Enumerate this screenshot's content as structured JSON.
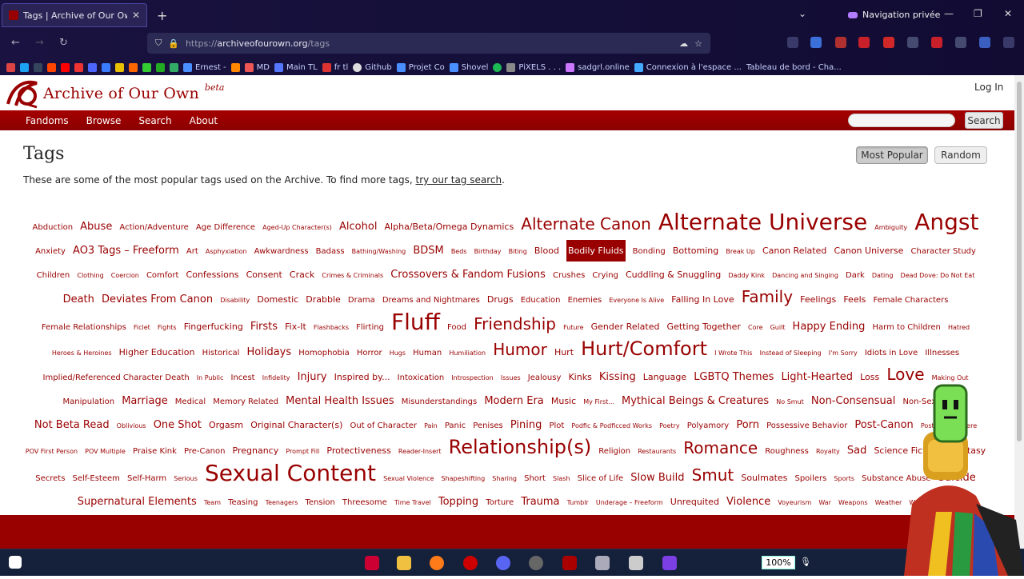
{
  "browser": {
    "tab_title": "Tags | Archive of Our Own",
    "tab_close": "✕",
    "new_tab": "+",
    "private_label": "Navigation privée",
    "url_prefix": "https://",
    "url_host": "archiveofourown.org",
    "url_path": "/tags",
    "bookmarks": [
      "Ernest -",
      "MD",
      "Main TL",
      "fr tl",
      "Github",
      "Projet Co",
      "Shovel",
      "PiXELS . . .",
      "sadgrl.online",
      "Connexion à l'espace ...",
      "Tableau de bord - Cha..."
    ]
  },
  "site": {
    "name": "Archive of Our Own",
    "beta": "beta",
    "login": "Log In",
    "nav": [
      "Fandoms",
      "Browse",
      "Search",
      "About"
    ],
    "search_button": "Search"
  },
  "main": {
    "heading": "Tags",
    "sort_options": [
      "Most Popular",
      "Random"
    ],
    "active_sort": "Most Popular",
    "intro_text": "These are some of the most popular tags used on the Archive. To find more tags, ",
    "intro_link": "try our tag search",
    "intro_end": ".",
    "tags": [
      [
        "Abduction",
        1
      ],
      [
        "Abuse",
        3
      ],
      [
        "Action/Adventure",
        1
      ],
      [
        "Age Difference",
        1
      ],
      [
        "Aged-Up Character(s)",
        0
      ],
      [
        "Alcohol",
        3
      ],
      [
        "Alpha/Beta/Omega Dynamics",
        2
      ],
      [
        "Alternate Canon",
        5
      ],
      [
        "Alternate Universe",
        7
      ],
      [
        "Ambiguity",
        0
      ],
      [
        "Angst",
        7
      ],
      [
        "Anxiety",
        1
      ],
      [
        "AO3 Tags – Freeform",
        3
      ],
      [
        "Art",
        1
      ],
      [
        "Asphyxiation",
        0
      ],
      [
        "Awkwardness",
        1
      ],
      [
        "Badass",
        1
      ],
      [
        "Bathing/Washing",
        0
      ],
      [
        "BDSM",
        3
      ],
      [
        "Beds",
        0
      ],
      [
        "Birthday",
        0
      ],
      [
        "Biting",
        0
      ],
      [
        "Blood",
        2
      ],
      [
        "Bodily Fluids",
        2,
        "hl"
      ],
      [
        "Bonding",
        1
      ],
      [
        "Bottoming",
        2
      ],
      [
        "Break Up",
        0
      ],
      [
        "Canon Related",
        2
      ],
      [
        "Canon Universe",
        2
      ],
      [
        "Character Study",
        1
      ],
      [
        "Children",
        1
      ],
      [
        "Clothing",
        0
      ],
      [
        "Coercion",
        0
      ],
      [
        "Comfort",
        1
      ],
      [
        "Confessions",
        2
      ],
      [
        "Consent",
        2
      ],
      [
        "Crack",
        2
      ],
      [
        "Crimes & Criminals",
        0
      ],
      [
        "Crossovers & Fandom Fusions",
        3
      ],
      [
        "Crushes",
        1
      ],
      [
        "Crying",
        1
      ],
      [
        "Cuddling & Snuggling",
        2
      ],
      [
        "Daddy Kink",
        0
      ],
      [
        "Dancing and Singing",
        0
      ],
      [
        "Dark",
        1
      ],
      [
        "Dating",
        0
      ],
      [
        "Dead Dove: Do Not Eat",
        0
      ],
      [
        "Death",
        3
      ],
      [
        "Deviates From Canon",
        3
      ],
      [
        "Disability",
        0
      ],
      [
        "Domestic",
        2
      ],
      [
        "Drabble",
        2
      ],
      [
        "Drama",
        1
      ],
      [
        "Dreams and Nightmares",
        1
      ],
      [
        "Drugs",
        2
      ],
      [
        "Education",
        1
      ],
      [
        "Enemies",
        1
      ],
      [
        "Everyone Is Alive",
        0
      ],
      [
        "Falling In Love",
        2
      ],
      [
        "Family",
        5
      ],
      [
        "Feelings",
        2
      ],
      [
        "Feels",
        2
      ],
      [
        "Female Characters",
        1
      ],
      [
        "Female Relationships",
        1
      ],
      [
        "Ficlet",
        0
      ],
      [
        "Fights",
        0
      ],
      [
        "Fingerfucking",
        2
      ],
      [
        "Firsts",
        3
      ],
      [
        "Fix-It",
        2
      ],
      [
        "Flashbacks",
        0
      ],
      [
        "Flirting",
        1
      ],
      [
        "Fluff",
        7
      ],
      [
        "Food",
        1
      ],
      [
        "Friendship",
        5
      ],
      [
        "Future",
        0
      ],
      [
        "Gender Related",
        2
      ],
      [
        "Getting Together",
        2
      ],
      [
        "Core",
        0
      ],
      [
        "Guilt",
        0
      ],
      [
        "Happy Ending",
        3
      ],
      [
        "Harm to Children",
        1
      ],
      [
        "Hatred",
        0
      ],
      [
        "Heroes & Heroines",
        0
      ],
      [
        "Higher Education",
        2
      ],
      [
        "Historical",
        1
      ],
      [
        "Holidays",
        3
      ],
      [
        "Homophobia",
        1
      ],
      [
        "Horror",
        1
      ],
      [
        "Hugs",
        0
      ],
      [
        "Human",
        1
      ],
      [
        "Humiliation",
        0
      ],
      [
        "Humor",
        5
      ],
      [
        "Hurt",
        2
      ],
      [
        "Hurt/Comfort",
        6
      ],
      [
        "I Wrote This",
        0
      ],
      [
        "Instead of Sleeping",
        0
      ],
      [
        "I'm Sorry",
        0
      ],
      [
        "Idiots in Love",
        1
      ],
      [
        "Illnesses",
        1
      ],
      [
        "Implied/Referenced Character Death",
        1
      ],
      [
        "In Public",
        0
      ],
      [
        "Incest",
        1
      ],
      [
        "Infidelity",
        0
      ],
      [
        "Injury",
        3
      ],
      [
        "Inspired by...",
        2
      ],
      [
        "Intoxication",
        1
      ],
      [
        "Introspection",
        0
      ],
      [
        "Issues",
        0
      ],
      [
        "Jealousy",
        1
      ],
      [
        "Kinks",
        2
      ],
      [
        "Kissing",
        3
      ],
      [
        "Language",
        2
      ],
      [
        "LGBTQ Themes",
        3
      ],
      [
        "Light-Hearted",
        3
      ],
      [
        "Loss",
        2
      ],
      [
        "Love",
        5
      ],
      [
        "Making Out",
        0
      ],
      [
        "Manipulation",
        1
      ],
      [
        "Marriage",
        3
      ],
      [
        "Medical",
        1
      ],
      [
        "Memory Related",
        1
      ],
      [
        "Mental Health Issues",
        3
      ],
      [
        "Misunderstandings",
        1
      ],
      [
        "Modern Era",
        3
      ],
      [
        "Music",
        2
      ],
      [
        "My First...",
        0
      ],
      [
        "Mythical Beings & Creatures",
        3
      ],
      [
        "No Smut",
        0
      ],
      [
        "Non-Consensual",
        3
      ],
      [
        "Non-Sexual",
        1
      ],
      [
        "Not Beta Read",
        3
      ],
      [
        "Oblivious",
        0
      ],
      [
        "One Shot",
        3
      ],
      [
        "Orgasm",
        2
      ],
      [
        "Original Character(s)",
        2
      ],
      [
        "Out of Character",
        1
      ],
      [
        "Pain",
        0
      ],
      [
        "Panic",
        1
      ],
      [
        "Penises",
        1
      ],
      [
        "Pining",
        3
      ],
      [
        "Plot",
        1
      ],
      [
        "Podfic & Podficced Works",
        0
      ],
      [
        "Poetry",
        0
      ],
      [
        "Polyamory",
        1
      ],
      [
        "Porn",
        3
      ],
      [
        "Possessive Behavior",
        1
      ],
      [
        "Post-Canon",
        3
      ],
      [
        "Posted Elsewhere",
        0
      ],
      [
        "POV First Person",
        0
      ],
      [
        "POV Multiple",
        0
      ],
      [
        "Praise Kink",
        1
      ],
      [
        "Pre-Canon",
        1
      ],
      [
        "Pregnancy",
        2
      ],
      [
        "Prompt Fill",
        0
      ],
      [
        "Protectiveness",
        2
      ],
      [
        "Reader-Insert",
        0
      ],
      [
        "Relationship(s)",
        6
      ],
      [
        "Religion",
        1
      ],
      [
        "Restaurants",
        0
      ],
      [
        "Romance",
        5
      ],
      [
        "Roughness",
        1
      ],
      [
        "Royalty",
        0
      ],
      [
        "Sad",
        3
      ],
      [
        "Science Fiction & Fantasy",
        2
      ],
      [
        "Secrets",
        1
      ],
      [
        "Self-Esteem",
        1
      ],
      [
        "Self-Harm",
        1
      ],
      [
        "Serious",
        0
      ],
      [
        "Sexual Content",
        7
      ],
      [
        "Sexual Violence",
        0
      ],
      [
        "Shapeshifting",
        0
      ],
      [
        "Sharing",
        0
      ],
      [
        "Short",
        1
      ],
      [
        "Slash",
        0
      ],
      [
        "Slice of Life",
        1
      ],
      [
        "Slow Build",
        3
      ],
      [
        "Smut",
        5
      ],
      [
        "Soulmates",
        2
      ],
      [
        "Spoilers",
        1
      ],
      [
        "Sports",
        0
      ],
      [
        "Substance Abuse",
        1
      ],
      [
        "Suicide",
        3
      ],
      [
        "Supernatural Elements",
        3
      ],
      [
        "Team",
        0
      ],
      [
        "Teasing",
        1
      ],
      [
        "Teenagers",
        0
      ],
      [
        "Tension",
        1
      ],
      [
        "Threesome",
        1
      ],
      [
        "Time Travel",
        0
      ],
      [
        "Topping",
        3
      ],
      [
        "Torture",
        1
      ],
      [
        "Trauma",
        3
      ],
      [
        "Tumblr",
        0
      ],
      [
        "Underage – Freeform",
        0
      ],
      [
        "Unrequited",
        2
      ],
      [
        "Violence",
        3
      ],
      [
        "Voyeurism",
        0
      ],
      [
        "War",
        0
      ],
      [
        "Weapons",
        0
      ],
      [
        "Weather",
        0
      ],
      [
        "Whump",
        0
      ]
    ]
  },
  "taskbar": {
    "battery": "100%"
  },
  "colors": {
    "brand": "#990000",
    "chrome": "#15103a"
  }
}
